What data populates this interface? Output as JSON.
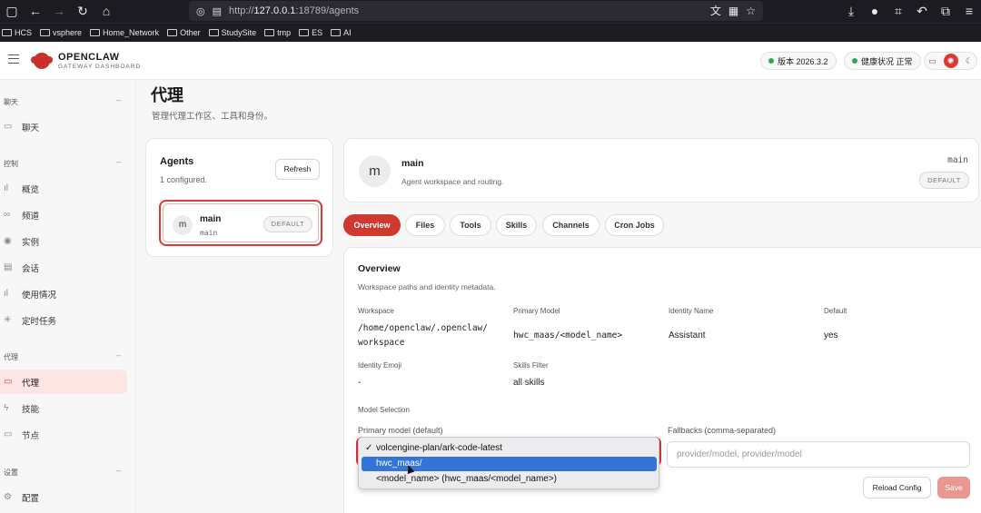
{
  "browser": {
    "url_prefix": "http://",
    "url_host": "127.0.0.1",
    "url_rest": ":18789/agents",
    "bookmarks": [
      "HCS",
      "vsphere",
      "Home_Network",
      "Other",
      "StudySite",
      "tmp",
      "ES",
      "AI"
    ]
  },
  "header": {
    "brand": "OPENCLAW",
    "brand_sub": "GATEWAY DASHBOARD",
    "version_label": "版本 2026.3.2",
    "health_label": "健康状况 正常"
  },
  "sidebar": {
    "sections": [
      {
        "title": "聊天",
        "items": [
          "聊天"
        ]
      },
      {
        "title": "控制",
        "items": [
          "概览",
          "频道",
          "实例",
          "会话",
          "使用情况",
          "定时任务"
        ]
      },
      {
        "title": "代理",
        "items": [
          "代理",
          "技能",
          "节点"
        ]
      },
      {
        "title": "设置",
        "items": [
          "配置"
        ]
      }
    ],
    "active_item": "代理"
  },
  "page": {
    "title": "代理",
    "subtitle": "管理代理工作区、工具和身份。"
  },
  "agents_panel": {
    "title": "Agents",
    "count": "1 configured.",
    "refresh": "Refresh",
    "agent": {
      "avatar": "m",
      "name": "main",
      "id": "main",
      "badge": "DEFAULT"
    }
  },
  "detail": {
    "avatar": "m",
    "name": "main",
    "description": "Agent workspace and routing.",
    "id": "main",
    "badge": "DEFAULT"
  },
  "tabs": [
    "Overview",
    "Files",
    "Tools",
    "Skills",
    "Channels",
    "Cron Jobs"
  ],
  "overview": {
    "title": "Overview",
    "subtitle": "Workspace paths and identity metadata.",
    "workspace_label": "Workspace",
    "workspace_value_1": "/home/openclaw/.openclaw/",
    "workspace_value_2": "workspace",
    "primary_model_label": "Primary Model",
    "primary_model_value": "hwc_maas/<model_name>",
    "identity_name_label": "Identity Name",
    "identity_name_value": "Assistant",
    "default_label": "Default",
    "default_value": "yes",
    "identity_emoji_label": "Identity Emoji",
    "identity_emoji_value": "-",
    "skills_filter_label": "Skills Filter",
    "skills_filter_value": "all skills",
    "model_selection_label": "Model Selection",
    "primary_default_label": "Primary model (default)",
    "fallbacks_label": "Fallbacks (comma-separated)",
    "fallbacks_placeholder": "provider/model, provider/model",
    "reload": "Reload Config",
    "save": "Save"
  },
  "dropdown": {
    "options": [
      "volcengine-plan/ark-code-latest",
      "hwc_maas/",
      "<model_name> (hwc_maas/<model_name>)"
    ],
    "selected_index": 0,
    "highlighted_index": 1
  }
}
